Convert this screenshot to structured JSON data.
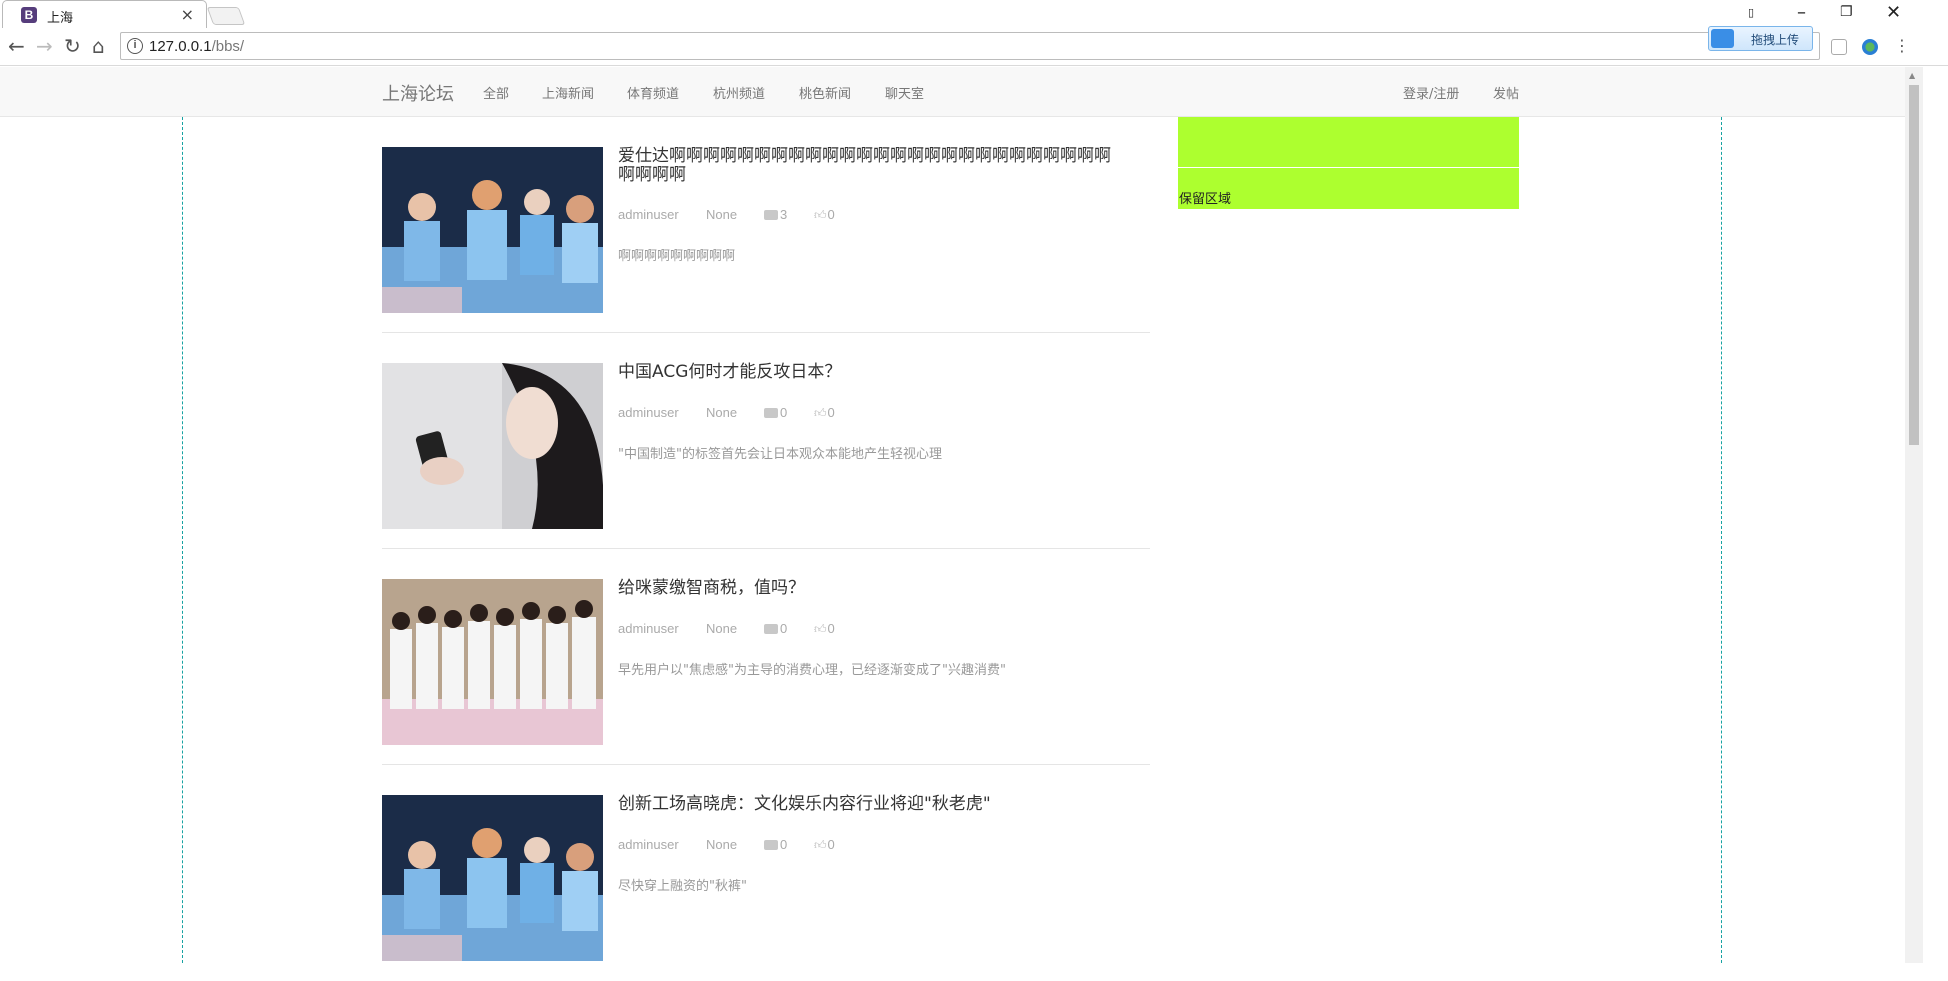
{
  "browser": {
    "tab_title": "上海",
    "favicon_letter": "B",
    "url_host": "127.0.0.1",
    "url_path": "/bbs/",
    "upload_button": "拖拽上传"
  },
  "navbar": {
    "brand": "上海论坛",
    "links": [
      "全部",
      "上海新闻",
      "体育频道",
      "杭州频道",
      "桃色新闻",
      "聊天室"
    ],
    "login": "登录/注册",
    "post": "发帖"
  },
  "posts": [
    {
      "title": "爱仕达啊啊啊啊啊啊啊啊啊啊啊啊啊啊啊啊啊啊啊啊啊啊啊啊啊啊啊啊啊啊",
      "author": "adminuser",
      "date": "None",
      "comments": "3",
      "likes": "0",
      "summary": "啊啊啊啊啊啊啊啊啊",
      "image": "idol-group-stage"
    },
    {
      "title": "中国ACG何时才能反攻日本？",
      "author": "adminuser",
      "date": "None",
      "comments": "0",
      "likes": "0",
      "summary": "\"中国制造\"的标签首先会让日本观众本能地产生轻视心理",
      "image": "woman-with-phone"
    },
    {
      "title": "给咪蒙缴智商税，值吗？",
      "author": "adminuser",
      "date": "None",
      "comments": "0",
      "likes": "0",
      "summary": "早先用户以\"焦虑感\"为主导的消费心理，已经逐渐变成了\"兴趣消费\"",
      "image": "girls-in-white-dresses"
    },
    {
      "title": "创新工场高晓虎：文化娱乐内容行业将迎\"秋老虎\"",
      "author": "adminuser",
      "date": "None",
      "comments": "0",
      "likes": "0",
      "summary": "尽快穿上融资的\"秋裤\"",
      "image": "idol-group-stage"
    }
  ],
  "sidebar": {
    "reserve_label": "保留区域",
    "reserve_color": "#adff2f"
  },
  "colors": {
    "navbar_bg": "#f8f8f8",
    "divider_dashed": "#17a2a2",
    "meta_text": "#aaaaaa"
  }
}
